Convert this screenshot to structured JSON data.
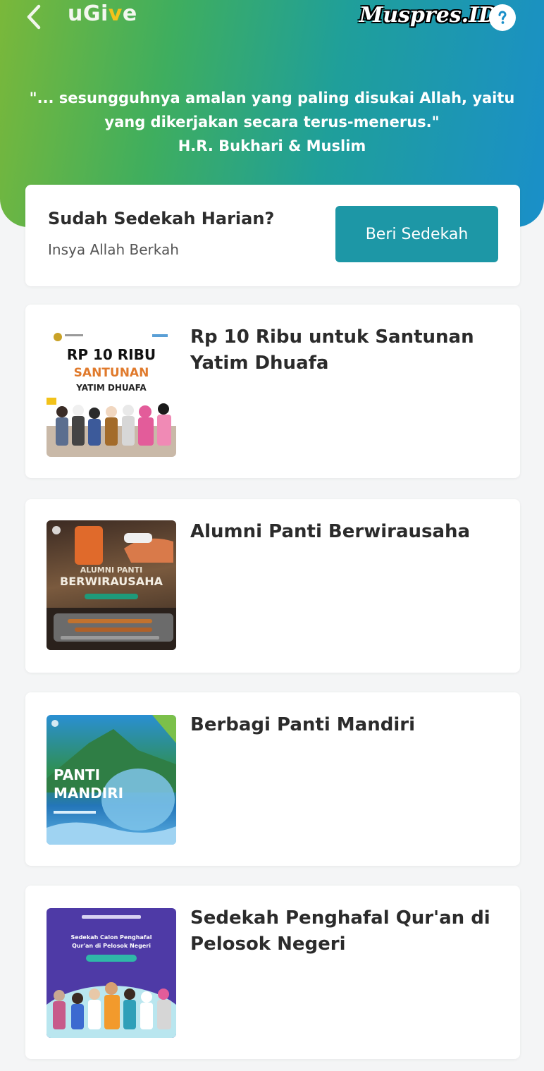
{
  "header": {
    "brand_prefix": "uGi",
    "brand_accent": "v",
    "brand_suffix": "e",
    "watermark": "Muspres.ID",
    "quote_line1": "\"... sesungguhnya amalan yang paling disukai Allah, yaitu",
    "quote_line2": "yang dikerjakan secara terus-menerus.\"",
    "quote_source": "H.R. Bukhari & Muslim",
    "colors": {
      "gradient_start": "#7ab83a",
      "gradient_end": "#1a8fc9",
      "brand_accent": "#f2c21a"
    },
    "icons": {
      "back": "chevron-left-icon",
      "help": "question-mark-icon"
    }
  },
  "daily": {
    "title": "Sudah Sedekah Harian?",
    "subtitle": "Insya Allah Berkah",
    "button_label": "Beri Sedekah",
    "button_color": "#1d97a6"
  },
  "programs": [
    {
      "title_line1": "Rp 10 Ribu untuk Santunan",
      "title_line2": "Yatim Dhuafa",
      "thumb_line1": "RP 10 RIBU",
      "thumb_line2": "SANTUNAN",
      "thumb_line3": "YATIM DHUAFA"
    },
    {
      "title_line1": "Alumni Panti Berwirausaha",
      "thumb_line1": "ALUMNI PANTI",
      "thumb_line2": "BERWIRAUSAHA"
    },
    {
      "title_line1": "Berbagi Panti Mandiri",
      "thumb_line1": "PANTI",
      "thumb_line2": "MANDIRI"
    },
    {
      "title_line1": "Sedekah Penghafal Qur'an di",
      "title_line2": "Pelosok Negeri",
      "thumb_line1": "Sedekah Calon Penghafal",
      "thumb_line2": "Qur'an di Pelosok Negeri"
    }
  ]
}
